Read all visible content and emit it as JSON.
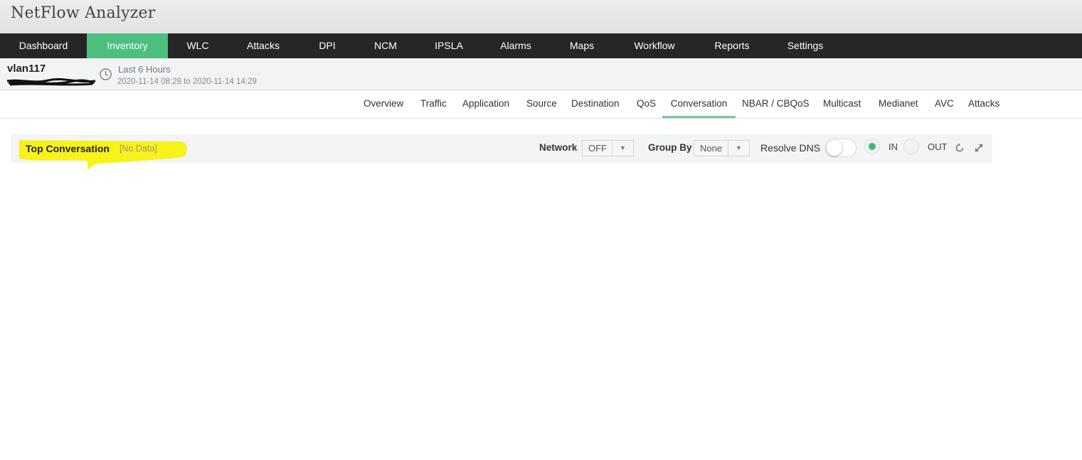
{
  "app": {
    "title": "NetFlow Analyzer"
  },
  "main_nav": {
    "active": "Inventory",
    "items": [
      "Dashboard",
      "Inventory",
      "WLC",
      "Attacks",
      "DPI",
      "NCM",
      "IPSLA",
      "Alarms",
      "Maps",
      "Workflow",
      "Reports",
      "Settings"
    ]
  },
  "device": {
    "name": "vlan117",
    "time_range_label": "Last 6 Hours",
    "time_range_dates": "2020-11-14 08:29 to 2020-11-14 14:29"
  },
  "sub_nav": {
    "active": "Conversation",
    "tabs": [
      "Overview",
      "Traffic",
      "Application",
      "Source",
      "Destination",
      "QoS",
      "Conversation",
      "NBAR / CBQoS",
      "Multicast",
      "Medianet",
      "AVC",
      "Attacks"
    ]
  },
  "panel": {
    "title": "Top Conversation",
    "status": "[No Data]",
    "network_label": "Network",
    "network_value": "OFF",
    "group_by_label": "Group By",
    "group_by_value": "None",
    "resolve_dns_label": "Resolve DNS",
    "resolve_dns_on": false,
    "direction_in_label": "IN",
    "direction_out_label": "OUT",
    "direction_selected": "IN"
  },
  "colors": {
    "nav_bg": "#262626",
    "nav_active": "#4cbf7f",
    "tab_underline": "#78c89a",
    "highlight": "#f7f21a",
    "radio_on": "#3dbb74"
  },
  "icons": [
    "clock-icon",
    "chevron-down-icon",
    "refresh-icon",
    "collapse-icon"
  ]
}
